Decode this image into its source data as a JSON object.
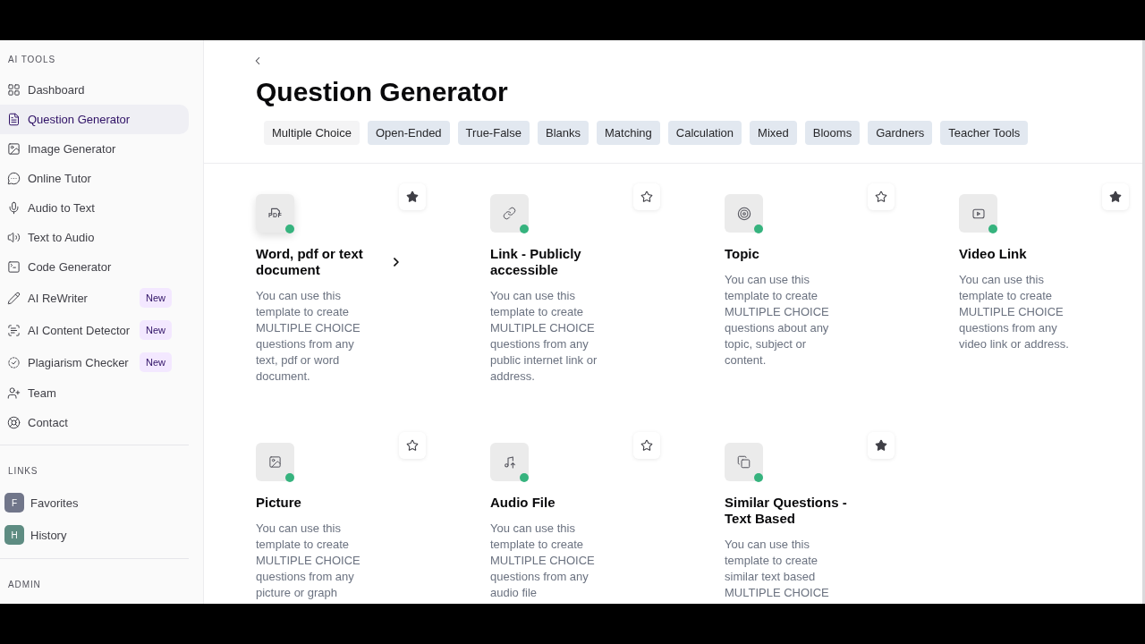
{
  "sidebar": {
    "sections": [
      {
        "heading": "AI TOOLS",
        "kind": "nav",
        "items": [
          {
            "label": "Dashboard",
            "selected": false
          },
          {
            "label": "Question Generator",
            "selected": true
          },
          {
            "label": "Image Generator",
            "selected": false
          },
          {
            "label": "Online Tutor",
            "selected": false
          },
          {
            "label": "Audio to Text",
            "selected": false
          },
          {
            "label": "Text to Audio",
            "selected": false
          },
          {
            "label": "Code Generator",
            "selected": false
          },
          {
            "label": "AI ReWriter",
            "selected": false,
            "badge": "New"
          },
          {
            "label": "AI Content Detector",
            "selected": false,
            "badge": "New"
          },
          {
            "label": "Plagiarism Checker",
            "selected": false,
            "badge": "New"
          },
          {
            "label": "Team",
            "selected": false
          },
          {
            "label": "Contact",
            "selected": false
          }
        ]
      },
      {
        "heading": "LINKS",
        "kind": "links",
        "items": [
          {
            "label": "Favorites",
            "initial": "F",
            "color": "#71768a"
          },
          {
            "label": "History",
            "initial": "H",
            "color": "#5e8c82"
          }
        ]
      },
      {
        "heading": "ADMIN",
        "kind": "heading"
      }
    ]
  },
  "page": {
    "title": "Question Generator",
    "tabs": [
      {
        "label": "Multiple Choice",
        "selected": true
      },
      {
        "label": "Open-Ended",
        "selected": false
      },
      {
        "label": "True-False",
        "selected": false
      },
      {
        "label": "Blanks",
        "selected": false
      },
      {
        "label": "Matching",
        "selected": false
      },
      {
        "label": "Calculation",
        "selected": false
      },
      {
        "label": "Mixed",
        "selected": false
      },
      {
        "label": "Blooms",
        "selected": false
      },
      {
        "label": "Gardners",
        "selected": false
      },
      {
        "label": "Teacher Tools",
        "selected": false
      }
    ]
  },
  "cards": [
    {
      "title": "Word, pdf or text document",
      "description": "You can use this template to create MULTIPLE CHOICE questions from any text, pdf or word document.",
      "icon_label": "PDF",
      "starred": true,
      "hovered": true
    },
    {
      "title": "Link - Publicly accessible",
      "description": "You can use this template to create MULTIPLE CHOICE questions from any public internet link or address.",
      "starred": false,
      "hovered": false
    },
    {
      "title": "Topic",
      "description": "You can use this template to create MULTIPLE CHOICE questions about any topic, subject or content.",
      "starred": false,
      "hovered": false
    },
    {
      "title": "Video Link",
      "description": "You can use this template to create MULTIPLE CHOICE questions from any video link or address.",
      "starred": true,
      "hovered": false
    },
    {
      "title": "Picture",
      "description": "You can use this template to create MULTIPLE CHOICE questions from any picture or graph",
      "starred": false,
      "hovered": false
    },
    {
      "title": "Audio File",
      "description": "You can use this template to create MULTIPLE CHOICE questions from any audio file",
      "starred": false,
      "hovered": false
    },
    {
      "title": "Similar Questions - Text Based",
      "description": "You can use this template to create similar text based MULTIPLE CHOICE",
      "starred": true,
      "hovered": false
    }
  ]
}
